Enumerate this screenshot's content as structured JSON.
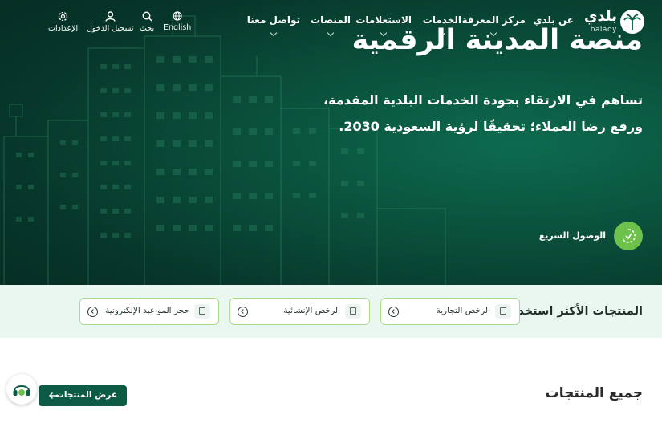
{
  "brand": {
    "name_ar": "بلدي",
    "name_en": "balady"
  },
  "nav": {
    "items": [
      {
        "label": "عن بلدي",
        "has_dropdown": false
      },
      {
        "label": "مركز المعرفة",
        "has_dropdown": true
      },
      {
        "label": "الخدمات",
        "has_dropdown": true
      },
      {
        "label": "الاستعلامات",
        "has_dropdown": true
      },
      {
        "label": "المنصات",
        "has_dropdown": true
      },
      {
        "label": "تواصل معنا",
        "has_dropdown": true
      }
    ]
  },
  "utilities": {
    "language": "English",
    "search": "بحث",
    "login": "تسجيل الدخول",
    "settings": "الإعدادات"
  },
  "hero": {
    "title": "منصة المدينة الرقمية",
    "subtitle": "تساهم في الارتقاء بجودة الخدمات البلدية المقدمة، ورفع رضا العملاء؛ تحقيقًا لرؤية السعودية 2030.",
    "quick_access": "الوصول السريع"
  },
  "most_used": {
    "title": "المنتجات الأكثر استخدامًا",
    "items": [
      {
        "label": "الرخص التجارية",
        "icon": "document-icon"
      },
      {
        "label": "الرخص الإنشائية",
        "icon": "building-doc-icon"
      },
      {
        "label": "حجز المواعيد الإلكترونية",
        "icon": "calendar-doc-icon"
      }
    ]
  },
  "all_products": {
    "title": "جميع المنتجات",
    "view_button": "عرض المنتجات"
  },
  "colors": {
    "hero_dark": "#07362a",
    "hero_mid": "#0a4f3b",
    "accent_green": "#6cc24a",
    "band_bg": "#eaf6f0",
    "primary_button": "#0b5b45"
  }
}
